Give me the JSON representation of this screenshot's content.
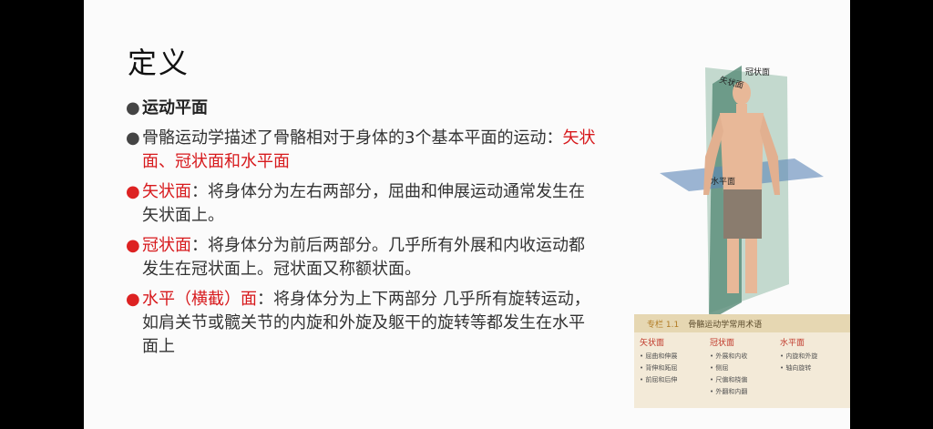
{
  "title": "定义",
  "bullets": [
    {
      "text": "运动平面"
    },
    {
      "pre": "骨骼运动学描述了骨骼相对于身体的3个基本平面的运动：",
      "highlight": "矢状面、冠状面和水平面"
    },
    {
      "term": "矢状面",
      "text": "：将身体分为左右两部分，屈曲和伸展运动通常发生在矢状面上。"
    },
    {
      "term": "冠状面",
      "text": "：将身体分为前后两部分。几乎所有外展和内收运动都发生在冠状面上。冠状面又称额状面。"
    },
    {
      "term": "水平（横截）面",
      "text": "：将身体分为上下两部分 几乎所有旋转运动，如肩关节或髋关节的内旋和外旋及躯干的旋转等都发生在水平面上"
    }
  ],
  "figure": {
    "labels": {
      "sagittal": "矢状面",
      "coronal": "冠状面",
      "horizontal": "水平面"
    },
    "box": {
      "tag": "专栏 1.1",
      "title": "骨骼运动学常用术语",
      "columns": [
        {
          "header": "矢状面",
          "items": [
            "屈曲和伸展",
            "背伸和跖屈",
            "前屈和后伸"
          ]
        },
        {
          "header": "冠状面",
          "items": [
            "外展和内收",
            "侧屈",
            "尺偏和桡偏",
            "外翻和内翻"
          ]
        },
        {
          "header": "水平面",
          "items": [
            "内旋和外旋",
            "轴向旋转"
          ]
        }
      ]
    }
  }
}
